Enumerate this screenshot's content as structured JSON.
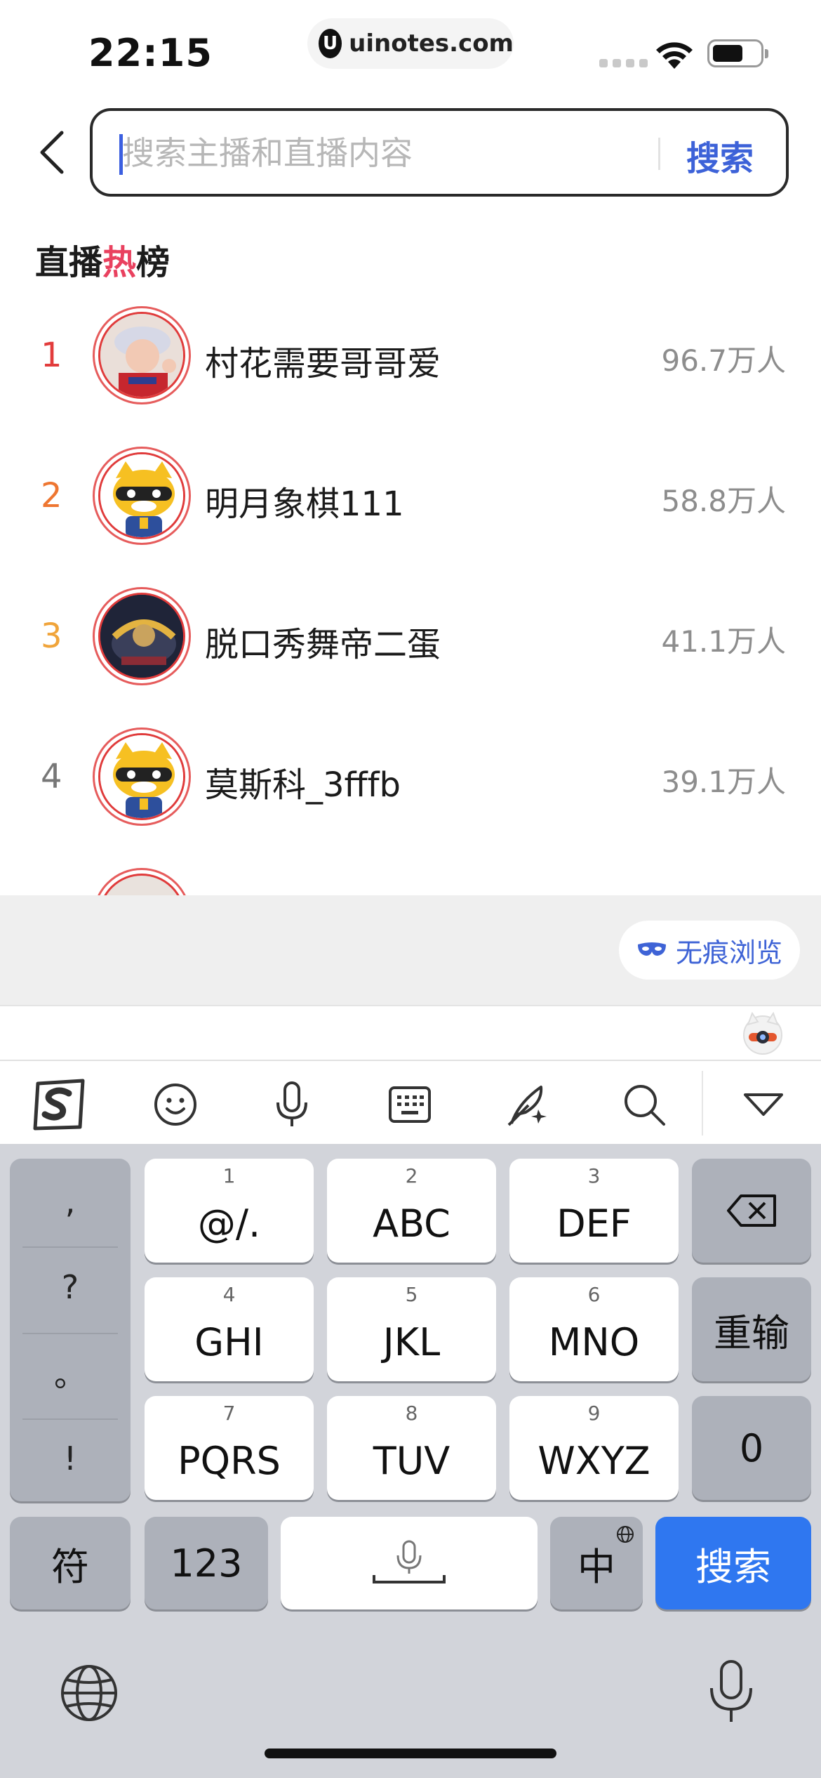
{
  "status_bar": {
    "time": "22:15",
    "watermark": "uinotes.com",
    "watermark_logo": "U"
  },
  "search": {
    "placeholder": "搜索主播和直播内容",
    "value": "",
    "button_label": "搜索"
  },
  "hot_list": {
    "title_part1": "直播",
    "title_hot": "热",
    "title_part2": "榜",
    "items": [
      {
        "rank": "1",
        "name": "村花需要哥哥爱",
        "viewers": "96.7万人",
        "rank_color": "#e23c3c"
      },
      {
        "rank": "2",
        "name": "明月象棋111",
        "viewers": "58.8万人",
        "rank_color": "#ee7631"
      },
      {
        "rank": "3",
        "name": "脱口秀舞帝二蛋",
        "viewers": "41.1万人",
        "rank_color": "#f0a43a"
      },
      {
        "rank": "4",
        "name": "莫斯科_3fffb",
        "viewers": "39.1万人",
        "rank_color": "#777777"
      }
    ]
  },
  "incognito": {
    "label": "无痕浏览"
  },
  "keyboard": {
    "punctuation": [
      ",",
      "?",
      "。",
      "!"
    ],
    "keys": [
      {
        "num": "1",
        "label": "@/."
      },
      {
        "num": "2",
        "label": "ABC"
      },
      {
        "num": "3",
        "label": "DEF"
      },
      {
        "num": "4",
        "label": "GHI"
      },
      {
        "num": "5",
        "label": "JKL"
      },
      {
        "num": "6",
        "label": "MNO"
      },
      {
        "num": "7",
        "label": "PQRS"
      },
      {
        "num": "8",
        "label": "TUV"
      },
      {
        "num": "9",
        "label": "WXYZ"
      }
    ],
    "retype_label": "重输",
    "zero_label": "0",
    "symbol_label": "符",
    "numbers_label": "123",
    "lang_label": "中",
    "enter_label": "搜索"
  }
}
